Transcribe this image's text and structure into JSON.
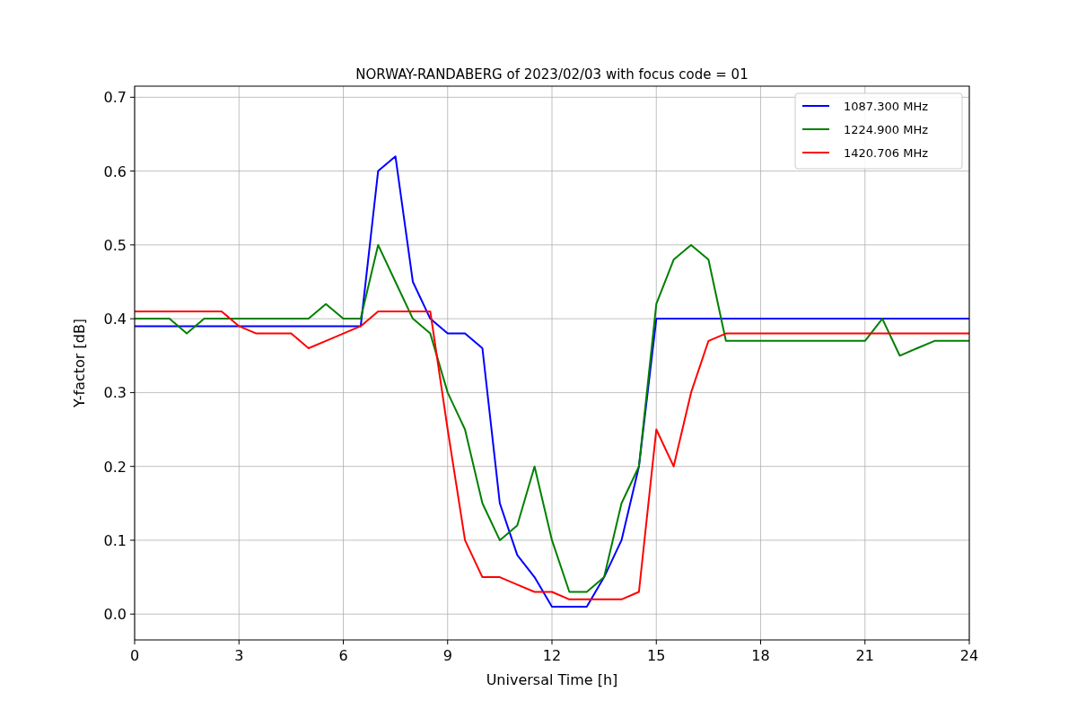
{
  "chart_data": {
    "type": "line",
    "title": "NORWAY-RANDABERG of 2023/02/03 with focus code = 01",
    "xlabel": "Universal Time [h]",
    "ylabel": "Y-factor [dB]",
    "x": [
      0,
      0.5,
      1,
      1.5,
      2,
      2.5,
      3,
      3.5,
      4,
      4.5,
      5,
      5.5,
      6,
      6.5,
      7,
      7.5,
      8,
      8.5,
      9,
      9.5,
      10,
      10.5,
      11,
      11.5,
      12,
      12.5,
      13,
      13.5,
      14,
      14.5,
      15,
      15.5,
      16,
      16.5,
      17,
      17.5,
      18,
      18.5,
      19,
      19.5,
      20,
      20.5,
      21,
      21.5,
      22,
      22.5,
      23,
      23.5,
      24
    ],
    "series": [
      {
        "name": "1087.300 MHz",
        "color": "#0000ff",
        "values": [
          0.39,
          0.39,
          0.39,
          0.39,
          0.39,
          0.39,
          0.39,
          0.39,
          0.39,
          0.39,
          0.39,
          0.39,
          0.39,
          0.39,
          0.6,
          0.62,
          0.45,
          0.4,
          0.38,
          0.38,
          0.36,
          0.15,
          0.08,
          0.05,
          0.01,
          0.01,
          0.01,
          0.05,
          0.1,
          0.2,
          0.4,
          0.4,
          0.4,
          0.4,
          0.4,
          0.4,
          0.4,
          0.4,
          0.4,
          0.4,
          0.4,
          0.4,
          0.4,
          0.4,
          0.4,
          0.4,
          0.4,
          0.4,
          0.4
        ]
      },
      {
        "name": "1224.900 MHz",
        "color": "#008000",
        "values": [
          0.4,
          0.4,
          0.4,
          0.38,
          0.4,
          0.4,
          0.4,
          0.4,
          0.4,
          0.4,
          0.4,
          0.42,
          0.4,
          0.4,
          0.5,
          0.45,
          0.4,
          0.38,
          0.3,
          0.25,
          0.15,
          0.1,
          0.12,
          0.2,
          0.1,
          0.03,
          0.03,
          0.05,
          0.15,
          0.2,
          0.42,
          0.48,
          0.5,
          0.48,
          0.37,
          0.37,
          0.37,
          0.37,
          0.37,
          0.37,
          0.37,
          0.37,
          0.37,
          0.4,
          0.35,
          0.36,
          0.37,
          0.37,
          0.37
        ]
      },
      {
        "name": "1420.706 MHz",
        "color": "#ff0000",
        "values": [
          0.41,
          0.41,
          0.41,
          0.41,
          0.41,
          0.41,
          0.39,
          0.38,
          0.38,
          0.38,
          0.36,
          0.37,
          0.38,
          0.39,
          0.41,
          0.41,
          0.41,
          0.41,
          0.25,
          0.1,
          0.05,
          0.05,
          0.04,
          0.03,
          0.03,
          0.02,
          0.02,
          0.02,
          0.02,
          0.03,
          0.25,
          0.2,
          0.3,
          0.37,
          0.38,
          0.38,
          0.38,
          0.38,
          0.38,
          0.38,
          0.38,
          0.38,
          0.38,
          0.38,
          0.38,
          0.38,
          0.38,
          0.38,
          0.38
        ]
      }
    ],
    "grid": true,
    "legend": true,
    "xlim": [
      0,
      24
    ],
    "ylim": [
      -0.035,
      0.715
    ],
    "xticks": [
      0,
      3,
      6,
      9,
      12,
      15,
      18,
      21,
      24
    ],
    "yticks": [
      {
        "value": 0,
        "label": "0.0"
      },
      {
        "value": 0.1,
        "label": "0.1"
      },
      {
        "value": 0.2,
        "label": "0.2"
      },
      {
        "value": 0.3,
        "label": "0.3"
      },
      {
        "value": 0.4,
        "label": "0.4"
      },
      {
        "value": 0.5,
        "label": "0.5"
      },
      {
        "value": 0.6,
        "label": "0.6"
      },
      {
        "value": 0.7,
        "label": "0.7"
      }
    ]
  }
}
